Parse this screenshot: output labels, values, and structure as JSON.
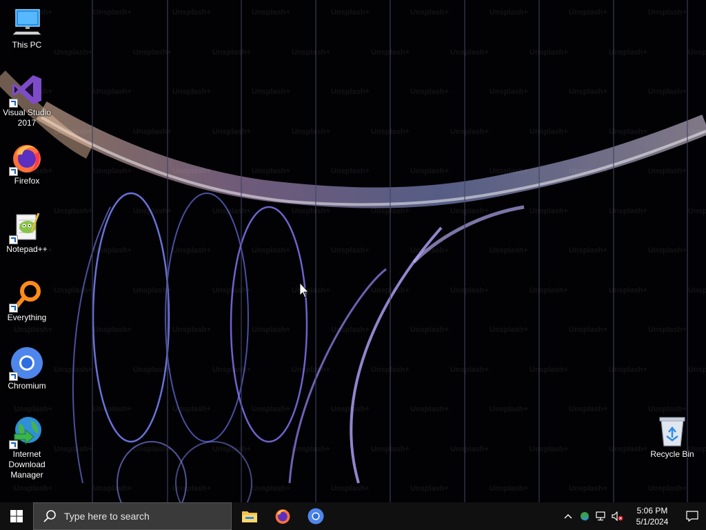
{
  "desktop": {
    "watermark_text": "Unsplash+",
    "icons": [
      {
        "label": "This PC"
      },
      {
        "label": "Visual Studio 2017"
      },
      {
        "label": "Firefox"
      },
      {
        "label": "Notepad++"
      },
      {
        "label": "Everything"
      },
      {
        "label": "Chromium"
      },
      {
        "label": "Internet Download Manager"
      },
      {
        "label": "Recycle Bin"
      }
    ]
  },
  "taskbar": {
    "search_placeholder": "Type here to search",
    "pinned": [
      "file-explorer-icon",
      "firefox-icon",
      "chromium-icon"
    ],
    "clock": {
      "time": "5:06 PM",
      "date": "5/1/2024"
    }
  },
  "colors": {
    "taskbar_bg": "#101010",
    "search_bg": "#3a3a3a",
    "accent_blue": "#0078d7"
  }
}
